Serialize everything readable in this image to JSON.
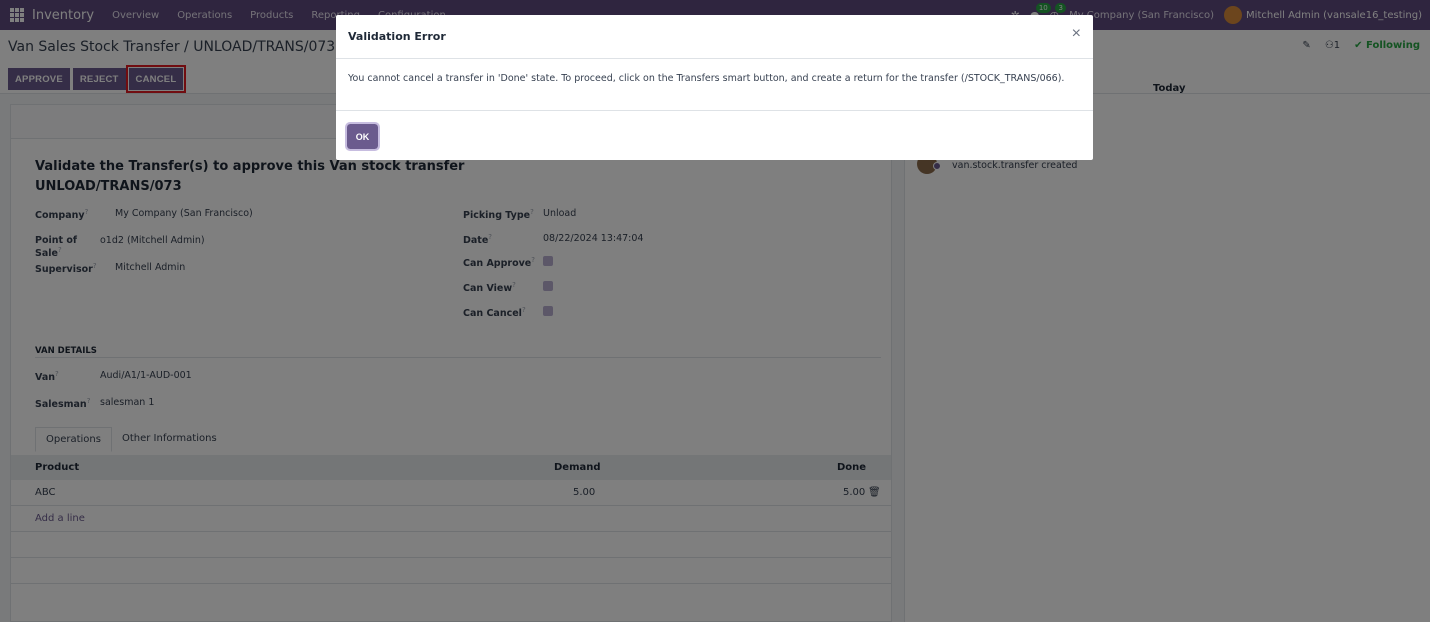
{
  "navbar": {
    "brand": "Inventory",
    "menu": [
      "Overview",
      "Operations",
      "Products",
      "Reporting",
      "Configuration"
    ],
    "chat_count": "10",
    "activity_count": "3",
    "company": "My Company (San Francisco)",
    "user": "Mitchell Admin (vansale16_testing)"
  },
  "control": {
    "breadcrumb": "Van Sales Stock Transfer / UNLOAD/TRANS/073",
    "buttons": {
      "approve": "APPROVE",
      "reject": "REJECT",
      "cancel": "CANCEL"
    },
    "followers": "1",
    "following": "Following"
  },
  "form": {
    "title_line1": "Validate the Transfer(s) to approve this Van stock transfer",
    "title_line2": "UNLOAD/TRANS/073",
    "left_fields": [
      {
        "label": "Company",
        "value": "My Company (San Francisco)"
      },
      {
        "label": "Point of Sale",
        "value": "o1d2 (Mitchell Admin)"
      },
      {
        "label": "Supervisor",
        "value": "Mitchell Admin"
      }
    ],
    "right_fields": [
      {
        "label": "Picking Type",
        "value": "Unload"
      },
      {
        "label": "Date",
        "value": "08/22/2024 13:47:04"
      },
      {
        "label": "Can Approve",
        "value": ""
      },
      {
        "label": "Can View",
        "value": ""
      },
      {
        "label": "Can Cancel",
        "value": ""
      }
    ],
    "van_section": "VAN DETAILS",
    "van_fields": [
      {
        "label": "Van",
        "value": "Audi/A1/1-AUD-001"
      },
      {
        "label": "Salesman",
        "value": "salesman 1"
      }
    ],
    "tabs": [
      "Operations",
      "Other Informations"
    ],
    "table": {
      "headers": {
        "product": "Product",
        "demand": "Demand",
        "done": "Done"
      },
      "rows": [
        {
          "product": "ABC",
          "demand": "5.00",
          "done": "5.00"
        }
      ],
      "add_line": "Add a line"
    }
  },
  "chatter": {
    "date_label": "Today",
    "message": "van.stock.transfer created"
  },
  "modal": {
    "title": "Validation Error",
    "close": "×",
    "body": "You cannot cancel a transfer in 'Done' state. To proceed, click on the Transfers smart button, and create a return for the transfer (/STOCK_TRANS/066).",
    "ok": "OK"
  },
  "icons": {
    "apps": "apps-grid-icon",
    "close": "close-icon",
    "trash": "trash-icon",
    "paperclip": "paperclip-icon",
    "user": "user-icon",
    "check": "check-icon"
  },
  "colors": {
    "navbar": "#5e4a7e",
    "primary": "#6b5b8e",
    "highlight": "#e31b23",
    "following": "#28a745"
  }
}
